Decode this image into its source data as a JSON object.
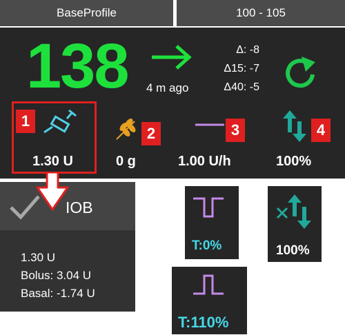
{
  "top_tabs": {
    "profile": "BaseProfile",
    "target": "100 - 105"
  },
  "glucose": {
    "value": "138",
    "time_ago": "4 m ago",
    "trend_icon": "arrow-right-icon",
    "color": "#1ee03c"
  },
  "deltas": {
    "delta": "Δ: -8",
    "delta15": "Δ15: -7",
    "delta40": "Δ40: -5"
  },
  "stats": {
    "iob": "1.30 U",
    "carbs": "0 g",
    "basal": "1.00 U/h",
    "profile_percent": "100%"
  },
  "badges": [
    "1",
    "2",
    "3",
    "4"
  ],
  "iob_dialog": {
    "title": "IOB",
    "lines": [
      "1.30 U",
      "Bolus: 3.04 U",
      "Basal: -1.74 U"
    ]
  },
  "tiles": {
    "temp_basal_zero": "T:0%",
    "temp_basal_110": "T:110%",
    "profile_percent": "100%"
  },
  "colors": {
    "accent_red": "#e02020",
    "cyan": "#46d7e6",
    "green": "#1ee03c",
    "purple": "#c58ae8",
    "teal": "#20a99b"
  }
}
